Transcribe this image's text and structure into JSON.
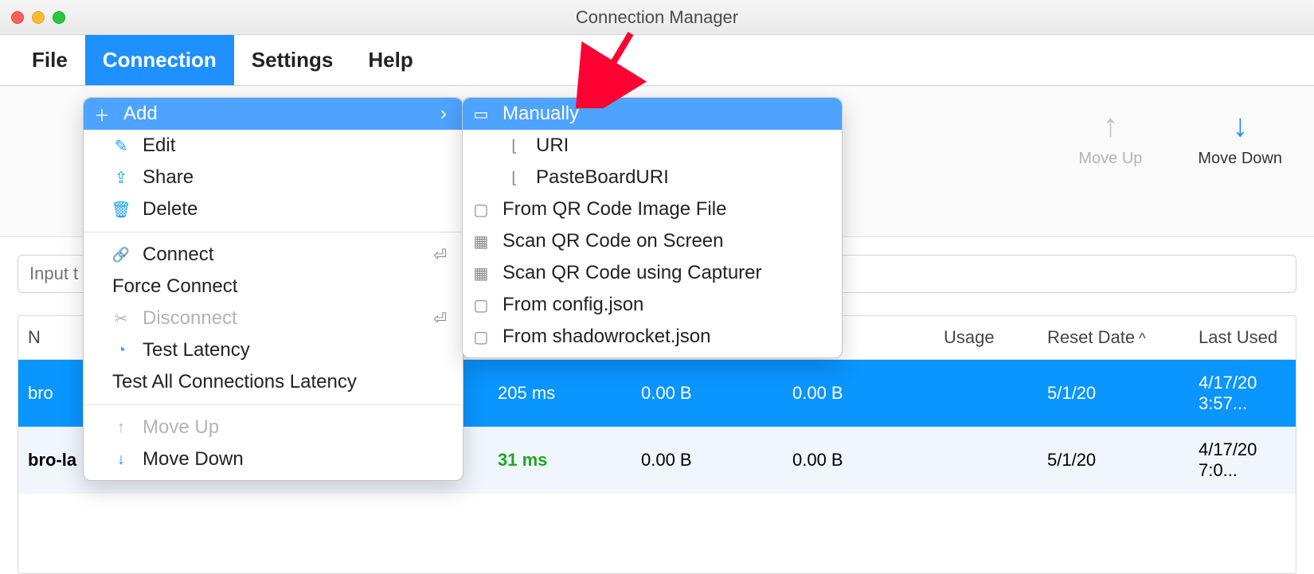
{
  "window": {
    "title": "Connection Manager"
  },
  "menubar": {
    "items": [
      {
        "label": "File",
        "active": false
      },
      {
        "label": "Connection",
        "active": true
      },
      {
        "label": "Settings",
        "active": false
      },
      {
        "label": "Help",
        "active": false
      }
    ]
  },
  "toolbar": {
    "move_up": "Move Up",
    "move_down": "Move Down"
  },
  "filter": {
    "placeholder": "Input t"
  },
  "dropdown": {
    "add": "Add",
    "edit": "Edit",
    "share": "Share",
    "delete": "Delete",
    "connect": "Connect",
    "force_connect": "Force Connect",
    "disconnect": "Disconnect",
    "test_latency": "Test Latency",
    "test_all": "Test All Connections Latency",
    "move_up": "Move Up",
    "move_down": "Move Down",
    "shortcut_enter": "⏎",
    "shortcut_enter2": "⏎"
  },
  "submenu": {
    "manually": "Manually",
    "uri": "URI",
    "pasteboard": "PasteBoardURI",
    "qr_file": "From QR Code Image File",
    "qr_screen": "Scan QR Code on Screen",
    "qr_capturer": "Scan QR Code using Capturer",
    "config_json": "From config.json",
    "shadowrocket": "From shadowrocket.json"
  },
  "table": {
    "columns": {
      "name": "N",
      "latency": "",
      "up": "",
      "down": "",
      "usage": "Usage",
      "reset": "Reset Date",
      "last_used": "Last Used"
    },
    "rows": [
      {
        "name": "bro",
        "latency": "205 ms",
        "up": "0.00  B",
        "down": "0.00  B",
        "reset": "5/1/20",
        "last_used": "4/17/20 3:57...",
        "selected": true
      },
      {
        "name": "bro-la",
        "latency": "31 ms",
        "up": "0.00  B",
        "down": "0.00  B",
        "reset": "5/1/20",
        "last_used": "4/17/20 7:0...",
        "selected": false
      }
    ]
  }
}
